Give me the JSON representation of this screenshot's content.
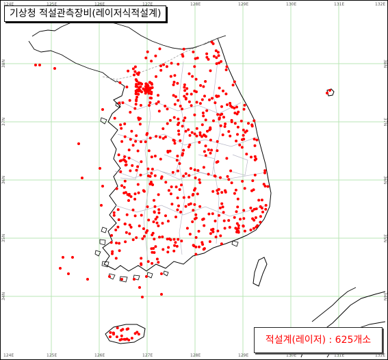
{
  "title": "기상청 적설관측장비(레이저식적설계)",
  "summary": {
    "label": "적설계(레이저)",
    "separator": " : ",
    "count": "625개소"
  },
  "colors": {
    "station": "#ff0000",
    "grid": "#b9e6b4",
    "coast": "#000000",
    "admin": "#b8b8c8"
  },
  "grid": {
    "longitudes": [
      "125E",
      "126E",
      "127E",
      "128E",
      "129E",
      "130E",
      "131E"
    ],
    "latitudes": [
      "38N",
      "37N",
      "36N",
      "35N",
      "34N"
    ],
    "frame_labels": [
      "124E",
      "132E"
    ]
  },
  "stations": {
    "count": 625,
    "marker": "red-dot"
  }
}
